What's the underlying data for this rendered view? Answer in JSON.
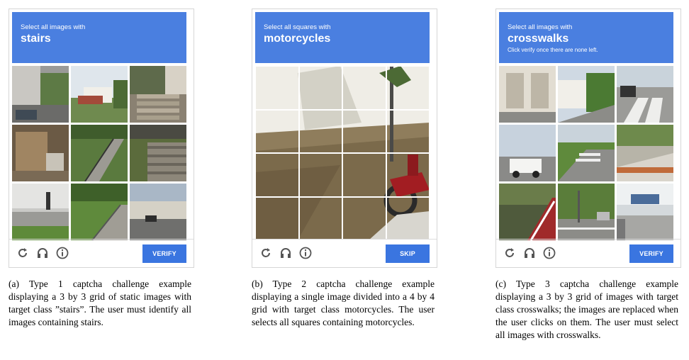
{
  "panels": [
    {
      "prompt": "Select all images with",
      "target": "stairs",
      "button": "VERIFY",
      "caption": "(a) Type 1 captcha challenge example displaying a 3 by 3 grid of static images with target class ”stairs”. The user must identify all images containing stairs.",
      "grid": "3x3"
    },
    {
      "prompt": "Select all squares with",
      "target": "motorcycles",
      "button": "SKIP",
      "caption": "(b) Type 2 captcha challenge example displaying a single image divided into a 4 by 4 grid with target class motorcycles. The user selects all squares containing motorcycles.",
      "grid": "4x4"
    },
    {
      "prompt": "Select all images with",
      "target": "crosswalks",
      "note": "Click verify once there are none left.",
      "button": "VERIFY",
      "caption": "(c) Type 3 captcha challenge example displaying a 3 by 3 grid of images with target class crosswalks; the images are replaced when the user clicks on them. The user must select all images with crosswalks.",
      "grid": "3x3"
    }
  ],
  "colors": {
    "header": "#4a7fe0",
    "button": "#3a75e0"
  },
  "icons": [
    "reload-icon",
    "audio-icon",
    "info-icon"
  ]
}
